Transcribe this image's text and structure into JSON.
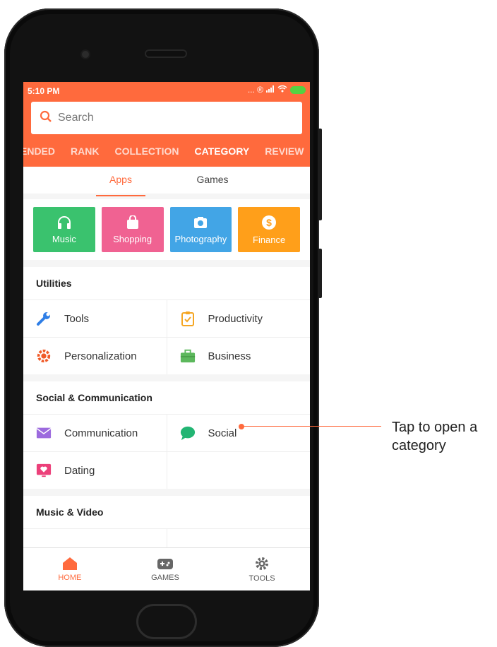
{
  "status": {
    "time": "5:10 PM",
    "icons_text": "... ®"
  },
  "search": {
    "placeholder": "Search"
  },
  "tabs": [
    {
      "label": "ENDED"
    },
    {
      "label": "RANK"
    },
    {
      "label": "COLLECTION"
    },
    {
      "label": "CATEGORY"
    },
    {
      "label": "REVIEW"
    }
  ],
  "segment": {
    "apps": "Apps",
    "games": "Games"
  },
  "tiles": [
    {
      "label": "Music",
      "color": "#3ac26e",
      "icon": "headphones-icon"
    },
    {
      "label": "Shopping",
      "color": "#f06292",
      "icon": "shopping-bag-icon"
    },
    {
      "label": "Photography",
      "color": "#42a5e6",
      "icon": "camera-icon"
    },
    {
      "label": "Finance",
      "color": "#ff9f1a",
      "icon": "dollar-icon"
    }
  ],
  "sections": {
    "utilities": {
      "title": "Utilities",
      "items": [
        "Tools",
        "Productivity",
        "Personalization",
        "Business"
      ]
    },
    "social": {
      "title": "Social & Communication",
      "items": [
        "Communication",
        "Social",
        "Dating"
      ]
    },
    "music": {
      "title": "Music & Video"
    }
  },
  "nav": {
    "home": "HOME",
    "games": "GAMES",
    "tools": "TOOLS"
  },
  "annotation": {
    "line1": "Tap to open a",
    "line2": "category"
  },
  "colors": {
    "accent": "#ff6a3d"
  }
}
